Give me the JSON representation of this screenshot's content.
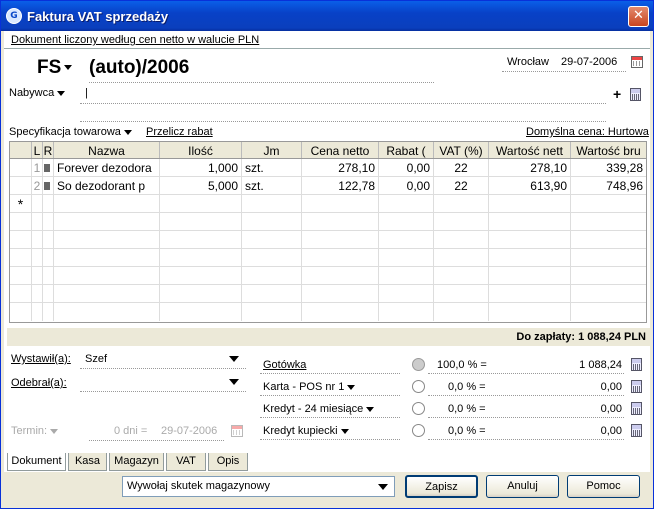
{
  "window": {
    "title": "Faktura VAT sprzedaży",
    "close_glyph": "✕",
    "icon": "app-logo-icon"
  },
  "header": {
    "pricing_note": "Dokument liczony według cen netto w walucie PLN",
    "doc_type": "FS",
    "doc_number": "(auto)/2006",
    "place": "Wrocław",
    "date": "29-07-2006"
  },
  "buyer": {
    "label": "Nabywca",
    "value": "|",
    "add_glyph": "+"
  },
  "spec": {
    "label": "Specyfikacja towarowa",
    "recalc_label": "Przelicz rabat",
    "default_price": "Domyślna cena: Hurtowa"
  },
  "table": {
    "headers": [
      "L",
      "R",
      "Nazwa",
      "Ilość",
      "Jm",
      "Cena netto",
      "Rabat (",
      "VAT (%)",
      "Wartość nett",
      "Wartość bru"
    ],
    "rows": [
      {
        "lp": "1",
        "name": "Forever dezodora",
        "qty": "1,000",
        "unit": "szt.",
        "price": "278,10",
        "discount": "0,00",
        "vat": "22",
        "net": "278,10",
        "gross": "339,28"
      },
      {
        "lp": "2",
        "name": "So dezodorant p",
        "qty": "5,000",
        "unit": "szt.",
        "price": "122,78",
        "discount": "0,00",
        "vat": "22",
        "net": "613,90",
        "gross": "748,96"
      }
    ],
    "new_row_marker": "*"
  },
  "total": {
    "text": "Do zapłaty: 1 088,24 PLN"
  },
  "issued": {
    "label": "Wystawił(a):",
    "value": "Szef"
  },
  "received": {
    "label": "Odebrał(a):",
    "value": ""
  },
  "term": {
    "label": "Termin:",
    "days": "0 dni =",
    "date": "29-07-2006"
  },
  "payments": [
    {
      "label": "Gotówka",
      "percent": "100,0 % =",
      "amount": "1 088,24",
      "selected": true
    },
    {
      "label": "Karta - POS nr 1",
      "percent": "0,0 % =",
      "amount": "0,00",
      "selected": false
    },
    {
      "label": "Kredyt - 24 miesiące",
      "percent": "0,0 % =",
      "amount": "0,00",
      "selected": false
    },
    {
      "label": "Kredyt kupiecki",
      "percent": "0,0 % =",
      "amount": "0,00",
      "selected": false
    }
  ],
  "tabs": [
    "Dokument",
    "Kasa",
    "Magazyn",
    "VAT",
    "Opis"
  ],
  "footer": {
    "warehouse_effect": "Wywołaj skutek magazynowy",
    "save": "Zapisz",
    "cancel": "Anuluj",
    "help": "Pomoc"
  }
}
